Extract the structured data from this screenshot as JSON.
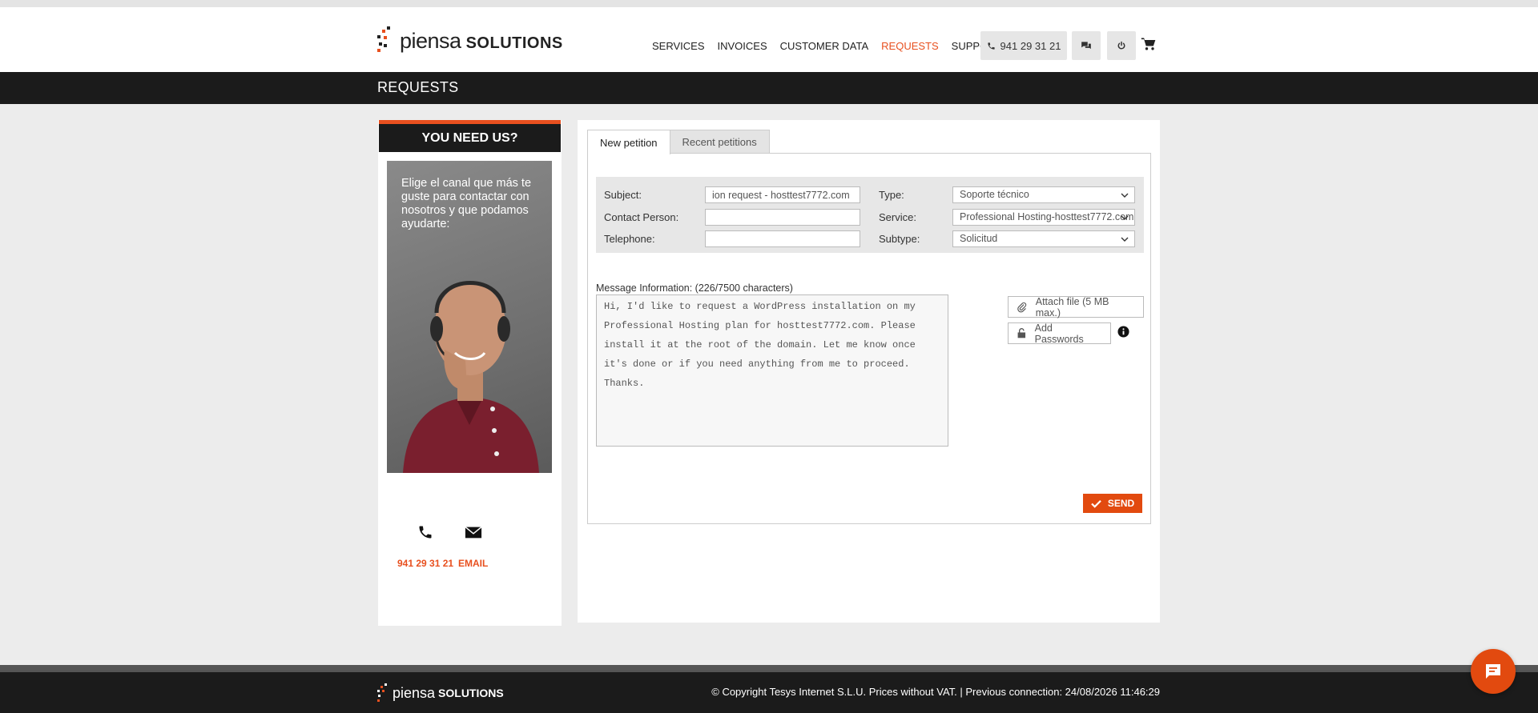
{
  "header": {
    "logo_text_light": "piensa",
    "logo_text_bold": "SOLUTIONS",
    "nav": [
      {
        "label": "SERVICES",
        "active": false
      },
      {
        "label": "INVOICES",
        "active": false
      },
      {
        "label": "CUSTOMER DATA",
        "active": false
      },
      {
        "label": "REQUESTS",
        "active": true
      },
      {
        "label": "SUPPORT",
        "active": false
      }
    ],
    "phone": "941 29 31 21",
    "icons": [
      "phone-icon",
      "chat-icon",
      "power-icon",
      "cart-icon"
    ]
  },
  "page_title": "REQUESTS",
  "sidebar": {
    "heading": "YOU NEED US?",
    "promo_text": "Elige el canal que más te guste para contactar con nosotros y que podamos ayudarte:",
    "phone_label": "941 29 31 21",
    "email_label": "EMAIL"
  },
  "tabs": [
    {
      "label": "New petition",
      "active": true
    },
    {
      "label": "Recent petitions",
      "active": false
    }
  ],
  "form": {
    "subject_label": "Subject:",
    "subject_value": "ion request - hosttest7772.com",
    "contact_label": "Contact Person:",
    "contact_value": "",
    "telephone_label": "Telephone:",
    "telephone_value": "",
    "type_label": "Type:",
    "type_value": "Soporte técnico",
    "service_label": "Service:",
    "service_value": "Professional Hosting-hosttest7772.com",
    "subtype_label": "Subtype:",
    "subtype_value": "Solicitud"
  },
  "message": {
    "label": "Message Information: (226/7500 characters)",
    "text": "Hi, I'd like to request a WordPress installation on my Professional Hosting plan for hosttest7772.com. Please install it at the root of the domain. Let me know once it's done or if you need anything from me to proceed. Thanks."
  },
  "buttons": {
    "attach": "Attach file (5 MB max.)",
    "passwords": "Add Passwords",
    "send": "SEND"
  },
  "footer": {
    "logo_text_light": "piensa",
    "logo_text_bold": "SOLUTIONS",
    "text": "© Copyright Tesys Internet S.L.U. Prices without VAT. | Previous connection: 24/08/2026 11:46:29"
  },
  "colors": {
    "accent": "#e8501f",
    "dark": "#1b1b1b",
    "background": "#ececec"
  }
}
